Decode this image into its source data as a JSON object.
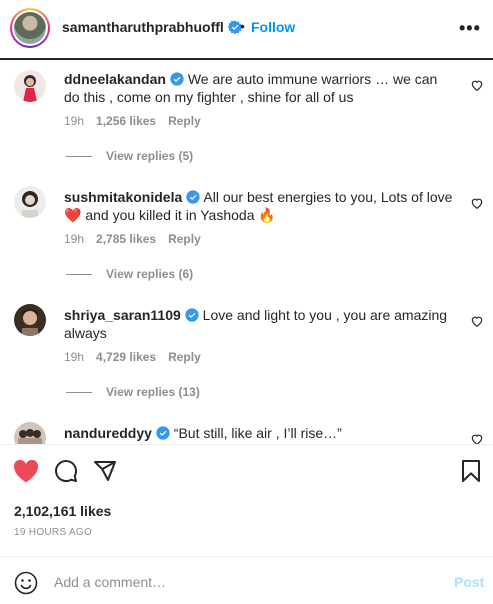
{
  "header": {
    "username": "samantharuthprabhuoffl",
    "separator": "•",
    "follow_label": "Follow",
    "more_label": "•••"
  },
  "comments": [
    {
      "username": "ddneelakandan",
      "verified": true,
      "text": "We are auto immune warriors … we can do this , come on my fighter , shine for all of us",
      "time": "19h",
      "likes": "1,256 likes",
      "reply_label": "Reply",
      "view_replies": "View replies (5)"
    },
    {
      "username": "sushmitakonidela",
      "verified": true,
      "text": "All our best energies to you, Lots of love ❤️ and you killed it in Yashoda 🔥",
      "time": "19h",
      "likes": "2,785 likes",
      "reply_label": "Reply",
      "view_replies": "View replies (6)"
    },
    {
      "username": "shriya_saran1109",
      "verified": true,
      "text": "Love and light to you , you are amazing always",
      "time": "19h",
      "likes": "4,729 likes",
      "reply_label": "Reply",
      "view_replies": "View replies (13)"
    },
    {
      "username": "nandureddyy",
      "verified": true,
      "text": "“But still, like air , I’ll rise…”"
    }
  ],
  "actions": {
    "likes_total": "2,102,161 likes",
    "time_ago": "19 HOURS AGO",
    "like_color": "#ed4956"
  },
  "add_comment": {
    "placeholder": "Add a comment…",
    "post_label": "Post"
  },
  "colors": {
    "accent": "#0095f6",
    "verified": "#3897f0",
    "muted": "#8e8e8e"
  }
}
